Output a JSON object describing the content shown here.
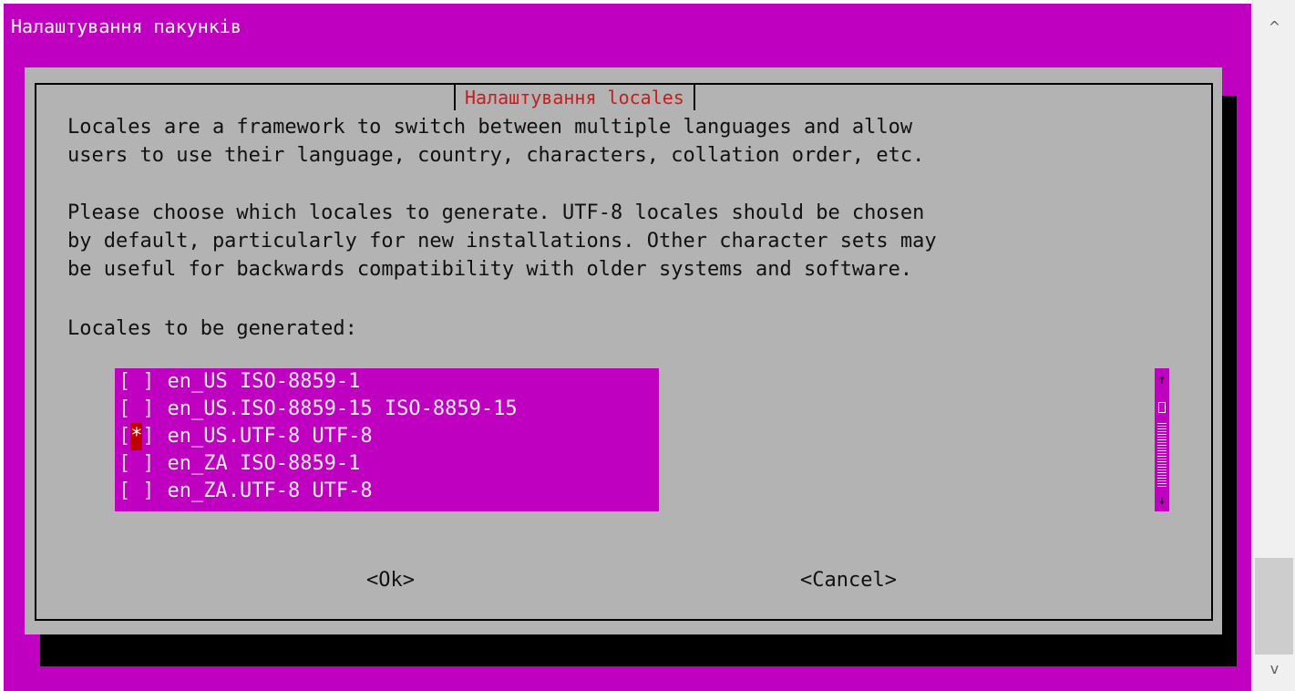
{
  "colors": {
    "terminal_bg": "#c000c0",
    "backtitle_fg": "#ffffff",
    "dialog_bg": "#b3b3b3",
    "title_fg": "#c02020",
    "list_bg": "#c000c0",
    "checked_mark_bg": "#c00000"
  },
  "backtitle": "Налаштування пакунків",
  "dialog": {
    "title": "Налаштування locales",
    "description_1": "Locales are a framework to switch between multiple languages and allow\nusers to use their language, country, characters, collation order, etc.",
    "description_2": "Please choose which locales to generate. UTF-8 locales should be chosen\nby default, particularly for new installations. Other character sets may\nbe useful for backwards compatibility with older systems and software.",
    "prompt": "Locales to be generated:",
    "locales": [
      {
        "mark": " ",
        "label": "en_US ISO-8859-1",
        "checked": false
      },
      {
        "mark": " ",
        "label": "en_US.ISO-8859-15 ISO-8859-15",
        "checked": false
      },
      {
        "mark": "*",
        "label": "en_US.UTF-8 UTF-8",
        "checked": true
      },
      {
        "mark": " ",
        "label": "en_ZA ISO-8859-1",
        "checked": false
      },
      {
        "mark": " ",
        "label": "en_ZA.UTF-8 UTF-8",
        "checked": false
      }
    ],
    "ok_label": "<Ok>",
    "cancel_label": "<Cancel>"
  },
  "icons": {
    "list_scroll_up": "↑",
    "list_scroll_down": "↓",
    "window_scroll_up": "^",
    "window_scroll_down": "v"
  }
}
